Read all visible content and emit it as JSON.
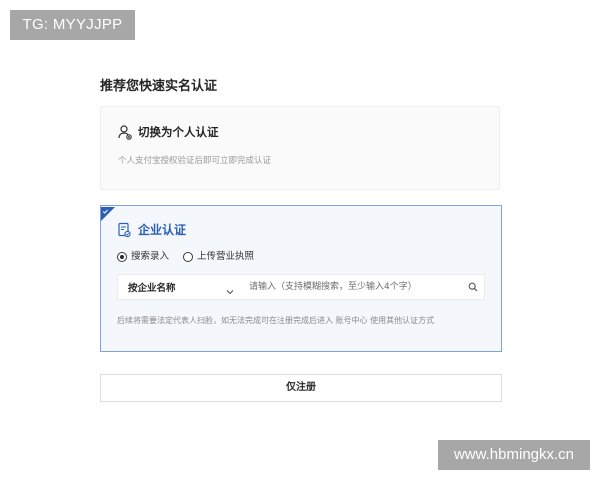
{
  "watermarks": {
    "top": "TG: MYYJJPP",
    "bottom": "www.hbmingkx.cn"
  },
  "page_title": "推荐您快速实名认证",
  "personal_card": {
    "icon": "user-switch-icon",
    "title": "切换为个人认证",
    "description": "个人支付宝授权验证后即可立即完成认证"
  },
  "enterprise_card": {
    "icon": "enterprise-document-icon",
    "title": "企业认证",
    "radios": [
      {
        "label": "搜索录入",
        "checked": true
      },
      {
        "label": "上传营业执照",
        "checked": false
      }
    ],
    "search": {
      "select_value": "按企业名称",
      "placeholder": "请输入（支持模糊搜索，至少输入4个字）"
    },
    "note": "后续将需要法定代表人扫脸，如无法完成可在注册完成后进入 账号中心 使用其他认证方式"
  },
  "register_button": "仅注册",
  "colors": {
    "accent": "#2a5fb6",
    "accent_border": "#7fa3d9",
    "enterprise_bg": "#f4f7fc",
    "personal_bg": "#fafafa",
    "watermark_bg": "#a7a7a7"
  }
}
